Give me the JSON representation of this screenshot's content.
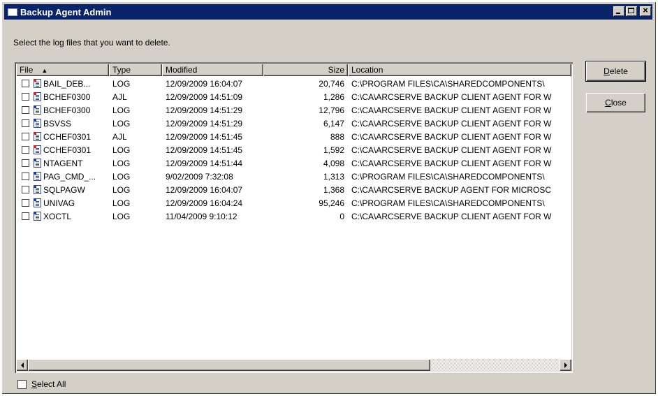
{
  "window": {
    "title": "Backup Agent Admin"
  },
  "instruction": "Select the log files that you want to delete.",
  "columns": [
    {
      "label": "File",
      "sort_indicator": "▲"
    },
    {
      "label": "Type"
    },
    {
      "label": "Modified"
    },
    {
      "label": "Size"
    },
    {
      "label": "Location"
    }
  ],
  "rows": [
    {
      "file": "BAIL_DEB...",
      "type": "LOG",
      "modified": "12/09/2009 16:04:07",
      "size": "20,746",
      "location": "C:\\PROGRAM FILES\\CA\\SHAREDCOMPONENTS\\",
      "icon": "red"
    },
    {
      "file": "BCHEF0300",
      "type": "AJL",
      "modified": "12/09/2009 14:51:09",
      "size": "1,286",
      "location": "C:\\CA\\ARCSERVE BACKUP CLIENT AGENT FOR W",
      "icon": "red"
    },
    {
      "file": "BCHEF0300",
      "type": "LOG",
      "modified": "12/09/2009 14:51:29",
      "size": "12,796",
      "location": "C:\\CA\\ARCSERVE BACKUP CLIENT AGENT FOR W",
      "icon": "blue"
    },
    {
      "file": "BSVSS",
      "type": "LOG",
      "modified": "12/09/2009 14:51:29",
      "size": "6,147",
      "location": "C:\\CA\\ARCSERVE BACKUP CLIENT AGENT FOR W",
      "icon": "blue"
    },
    {
      "file": "CCHEF0301",
      "type": "AJL",
      "modified": "12/09/2009 14:51:45",
      "size": "888",
      "location": "C:\\CA\\ARCSERVE BACKUP CLIENT AGENT FOR W",
      "icon": "red"
    },
    {
      "file": "CCHEF0301",
      "type": "LOG",
      "modified": "12/09/2009 14:51:45",
      "size": "1,592",
      "location": "C:\\CA\\ARCSERVE BACKUP CLIENT AGENT FOR W",
      "icon": "red"
    },
    {
      "file": "NTAGENT",
      "type": "LOG",
      "modified": "12/09/2009 14:51:44",
      "size": "4,098",
      "location": "C:\\CA\\ARCSERVE BACKUP CLIENT AGENT FOR W",
      "icon": "blue"
    },
    {
      "file": "PAG_CMD_...",
      "type": "LOG",
      "modified": "9/02/2009 7:32:08",
      "size": "1,313",
      "location": "C:\\PROGRAM FILES\\CA\\SHAREDCOMPONENTS\\",
      "icon": "blue"
    },
    {
      "file": "SQLPAGW",
      "type": "LOG",
      "modified": "12/09/2009 16:04:07",
      "size": "1,368",
      "location": "C:\\CA\\ARCSERVE BACKUP AGENT FOR MICROSC",
      "icon": "blue"
    },
    {
      "file": "UNIVAG",
      "type": "LOG",
      "modified": "12/09/2009 16:04:24",
      "size": "95,246",
      "location": "C:\\PROGRAM FILES\\CA\\SHAREDCOMPONENTS\\",
      "icon": "blue"
    },
    {
      "file": "XOCTL",
      "type": "LOG",
      "modified": "11/04/2009 9:10:12",
      "size": "0",
      "location": "C:\\CA\\ARCSERVE BACKUP CLIENT AGENT FOR W",
      "icon": "blue"
    }
  ],
  "buttons": {
    "delete": {
      "mnemonic": "D",
      "rest": "elete"
    },
    "close": {
      "mnemonic": "C",
      "rest": "lose"
    }
  },
  "select_all": {
    "mnemonic": "S",
    "rest": "elect All",
    "checked": false
  },
  "colors": {
    "titlebar": "#0a246a",
    "face": "#d4d0c8"
  }
}
